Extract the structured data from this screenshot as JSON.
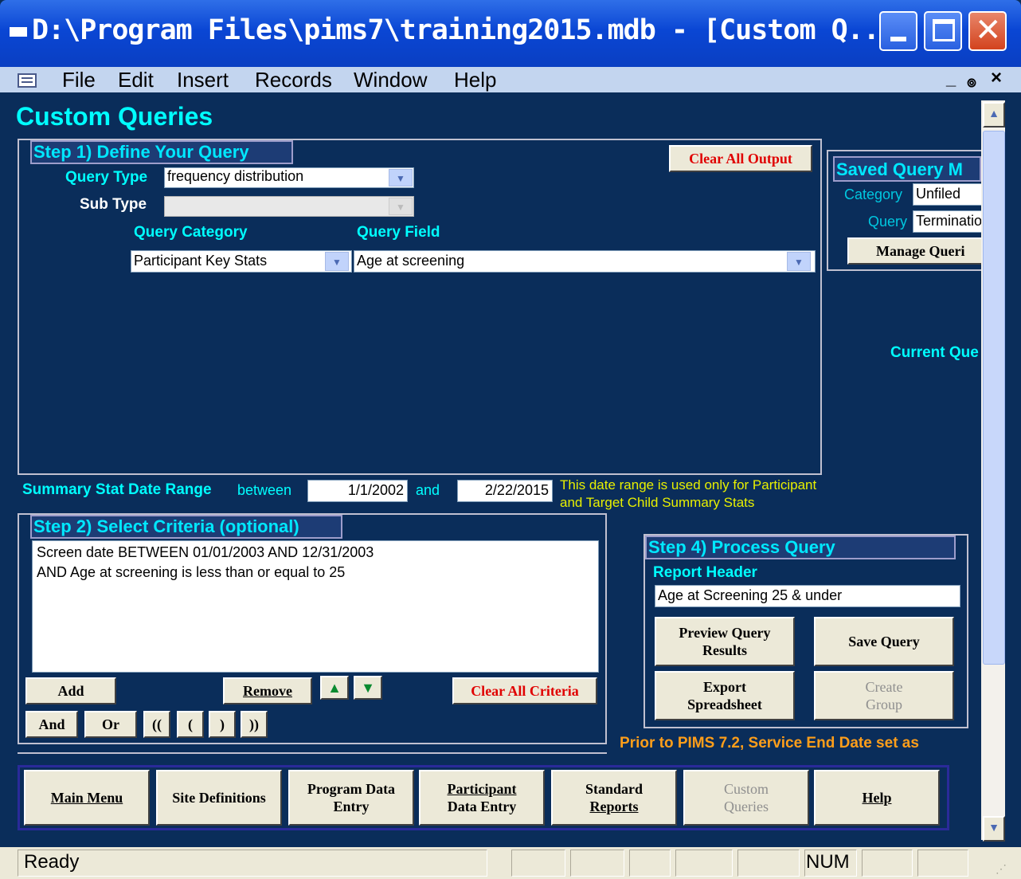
{
  "window": {
    "title": "D:\\Program Files\\pims7\\training2015.mdb - [Custom Q..."
  },
  "menu": [
    "File",
    "Edit",
    "Insert",
    "Records",
    "Window",
    "Help"
  ],
  "menu_right": {
    "restore": "๏",
    "close": "×",
    "minimize": "_"
  },
  "page_title": "Custom Queries",
  "step1": {
    "title": "Step 1) Define Your Query",
    "clear_output": "Clear All Output",
    "query_type_label": "Query Type",
    "query_type_value": "frequency distribution",
    "sub_type_label": "Sub Type",
    "query_category_label": "Query Category",
    "query_field_label": "Query Field",
    "query_category_value": "Participant Key Stats",
    "query_field_value": "Age at screening"
  },
  "saved": {
    "title": "Saved Query M",
    "category_label": "Category",
    "category_value": "Unfiled",
    "query_label": "Query",
    "query_value": "Terminatio",
    "manage": "Manage Queri"
  },
  "current_query_label": "Current Que",
  "summary": {
    "label": "Summary Stat Date Range",
    "between": "between",
    "from": "1/1/2002",
    "and": "and",
    "to": "2/22/2015",
    "note1": "This date range is used only for Participant",
    "note2": "and Target Child Summary Stats"
  },
  "step2": {
    "title": "Step 2) Select Criteria (optional)",
    "criteria": [
      "Screen date BETWEEN 01/01/2003 AND 12/31/2003",
      "AND Age at screening is less than or equal to 25"
    ],
    "add": "Add",
    "remove": "Remove",
    "clear": "Clear All Criteria",
    "and": "And",
    "or": "Or",
    "dparen_open": "((",
    "paren_open": "(",
    "paren_close": ")",
    "dparen_close": "))"
  },
  "step4": {
    "title": "Step 4) Process Query",
    "report_header_label": "Report Header",
    "report_header_value": "Age at Screening 25 & under",
    "preview_1": "Preview Query",
    "preview_2": "Results",
    "save": "Save Query",
    "export_1": "Export",
    "export_2": "Spreadsheet",
    "create_1": "Create",
    "create_2": "Group"
  },
  "notice": "Prior to PIMS 7.2, Service End Date set as",
  "nav": {
    "main_menu": "Main Menu",
    "site_def": "Site Definitions",
    "program_1": "Program  Data",
    "program_2": "Entry",
    "participant_1": "Participant",
    "participant_2": "Data Entry",
    "standard_1": "Standard",
    "standard_2": "Reports",
    "custom_1": "Custom",
    "custom_2": "Queries",
    "help": "Help"
  },
  "status": {
    "text": "Ready",
    "num": "NUM"
  },
  "colors": {
    "background": "#0a2d5a",
    "accent_cyan": "#00ffff",
    "warning_orange": "#ff9e1a",
    "error_red": "#e00000"
  }
}
